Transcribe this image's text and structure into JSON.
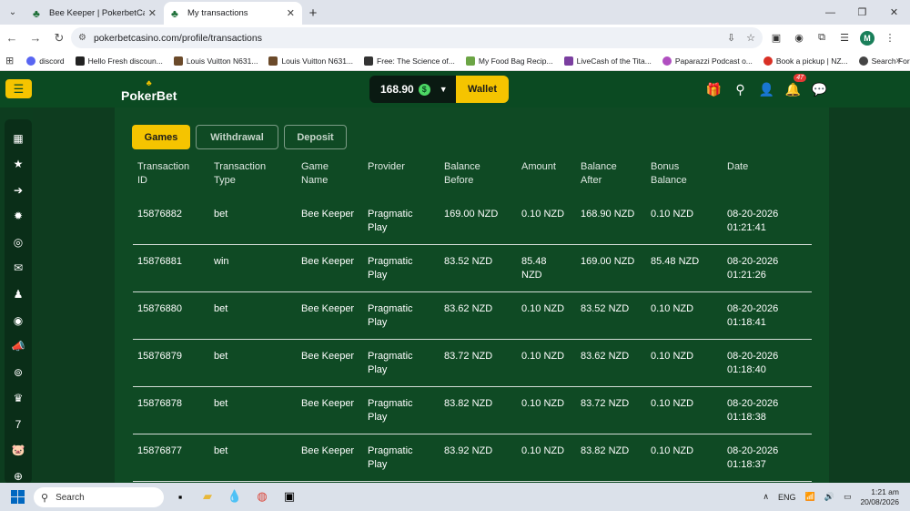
{
  "browser": {
    "tabs": [
      {
        "title": "Bee Keeper | PokerbetCasino",
        "active": false
      },
      {
        "title": "My transactions",
        "active": true
      }
    ],
    "url": "pokerbetcasino.com/profile/transactions",
    "bookmarks": [
      {
        "label": "discord",
        "color": "#5865f2"
      },
      {
        "label": "Hello Fresh discoun...",
        "color": "#222222"
      },
      {
        "label": "Louis Vuitton N631...",
        "color": "#6b4a2a"
      },
      {
        "label": "Louis Vuitton N631...",
        "color": "#6b4a2a"
      },
      {
        "label": "Free: The Science of...",
        "color": "#333333"
      },
      {
        "label": "My Food Bag Recip...",
        "color": "#6ca545"
      },
      {
        "label": "LiveCash of the Tita...",
        "color": "#7b3fa0"
      },
      {
        "label": "Paparazzi Podcast o...",
        "color": "#b04fc0"
      },
      {
        "label": "Book a pickup | NZ...",
        "color": "#d93025"
      },
      {
        "label": "Search Forums",
        "color": "#444444"
      }
    ],
    "profile_initial": "M"
  },
  "header": {
    "logo": "PokerBet",
    "balance": "168.90",
    "wallet_label": "Wallet",
    "notification_count": "47"
  },
  "filters": [
    {
      "label": "Games",
      "active": true
    },
    {
      "label": "Withdrawal",
      "active": false
    },
    {
      "label": "Deposit",
      "active": false
    }
  ],
  "table": {
    "headers": [
      [
        "Transaction",
        "ID"
      ],
      [
        "Transaction",
        "Type"
      ],
      [
        "Game",
        "Name"
      ],
      [
        "Provider",
        ""
      ],
      [
        "Balance",
        "Before"
      ],
      [
        "Amount",
        ""
      ],
      [
        "Balance",
        "After"
      ],
      [
        "Bonus",
        "Balance"
      ],
      [
        "Date",
        ""
      ]
    ],
    "rows": [
      {
        "id": "15876882",
        "type": "bet",
        "game": "Bee Keeper",
        "provider": [
          "Pragmatic",
          "Play"
        ],
        "before": "169.00 NZD",
        "amount": [
          "0.10 NZD",
          ""
        ],
        "after": "168.90 NZD",
        "bonus": "0.10 NZD",
        "date": [
          "08-20-2026",
          "01:21:41"
        ]
      },
      {
        "id": "15876881",
        "type": "win",
        "game": "Bee Keeper",
        "provider": [
          "Pragmatic",
          "Play"
        ],
        "before": "83.52 NZD",
        "amount": [
          "85.48",
          "NZD"
        ],
        "after": "169.00 NZD",
        "bonus": "85.48 NZD",
        "date": [
          "08-20-2026",
          "01:21:26"
        ]
      },
      {
        "id": "15876880",
        "type": "bet",
        "game": "Bee Keeper",
        "provider": [
          "Pragmatic",
          "Play"
        ],
        "before": "83.62 NZD",
        "amount": [
          "0.10 NZD",
          ""
        ],
        "after": "83.52 NZD",
        "bonus": "0.10 NZD",
        "date": [
          "08-20-2026",
          "01:18:41"
        ]
      },
      {
        "id": "15876879",
        "type": "bet",
        "game": "Bee Keeper",
        "provider": [
          "Pragmatic",
          "Play"
        ],
        "before": "83.72 NZD",
        "amount": [
          "0.10 NZD",
          ""
        ],
        "after": "83.62 NZD",
        "bonus": "0.10 NZD",
        "date": [
          "08-20-2026",
          "01:18:40"
        ]
      },
      {
        "id": "15876878",
        "type": "bet",
        "game": "Bee Keeper",
        "provider": [
          "Pragmatic",
          "Play"
        ],
        "before": "83.82 NZD",
        "amount": [
          "0.10 NZD",
          ""
        ],
        "after": "83.72 NZD",
        "bonus": "0.10 NZD",
        "date": [
          "08-20-2026",
          "01:18:38"
        ]
      },
      {
        "id": "15876877",
        "type": "bet",
        "game": "Bee Keeper",
        "provider": [
          "Pragmatic",
          "Play"
        ],
        "before": "83.92 NZD",
        "amount": [
          "0.10 NZD",
          ""
        ],
        "after": "83.82 NZD",
        "bonus": "0.10 NZD",
        "date": [
          "08-20-2026",
          "01:18:37"
        ]
      }
    ]
  },
  "taskbar": {
    "search_label": "Search",
    "language": "ENG",
    "time": "1:21 am",
    "date": "20/08/2026"
  },
  "colors": {
    "accent": "#f5c400",
    "header_bg": "#0b4a22",
    "content_bg": "#0f4a24"
  }
}
